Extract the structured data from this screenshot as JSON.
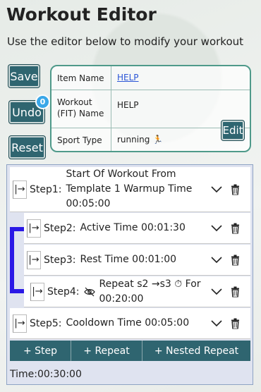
{
  "header": {
    "title": "Workout Editor",
    "subtitle": "Use the editor below to modify your workout"
  },
  "actions": {
    "save_label": "Save",
    "undo_label": "Undo",
    "undo_count": "0",
    "reset_label": "Reset"
  },
  "info": {
    "item_name_label": "Item Name",
    "item_name_value": "HELP",
    "workout_name_label": "Workout (FIT) Name",
    "workout_name_value": "HELP",
    "edit_label": "Edit",
    "sport_type_label": "Sport Type",
    "sport_type_value": "running 🏃"
  },
  "steps": [
    {
      "num": "Step1:",
      "text": "Start Of Workout From Template 1 Warmup Time 00:05:00",
      "color": "#f5a623"
    },
    {
      "num": "Step2:",
      "text": "Active Time 00:01:30",
      "color": "#e8141c"
    },
    {
      "num": "Step3:",
      "text": "Rest Time 00:01:00",
      "color": "#8c8c8c"
    },
    {
      "num": "Step4:",
      "text": "Repeat s2 →s3 ⏱ For 00:20:00",
      "color": "#2a18e6"
    },
    {
      "num": "Step5:",
      "text": "Cooldown Time 00:05:00",
      "color": "#2a18e6"
    }
  ],
  "bottom_actions": {
    "add_step": "+ Step",
    "add_repeat": "+ Repeat",
    "add_nested_repeat": "+ Nested Repeat"
  },
  "total": {
    "time_text": "Time:00:30:00"
  }
}
